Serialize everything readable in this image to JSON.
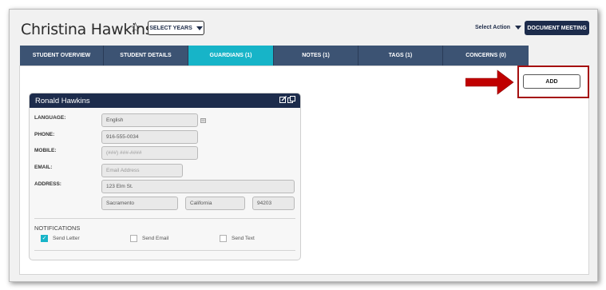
{
  "header": {
    "student_name": "Christina Hawkins",
    "star_icon": "star-outline-icon",
    "select_years_label": "SELECT YEARS",
    "select_action_label": "Select Action",
    "document_meeting_label": "DOCUMENT MEETING"
  },
  "tabs": [
    {
      "label": "STUDENT OVERVIEW",
      "active": false
    },
    {
      "label": "STUDENT DETAILS",
      "active": false
    },
    {
      "label": "GUARDIANS (1)",
      "active": true
    },
    {
      "label": "NOTES (1)",
      "active": false
    },
    {
      "label": "TAGS (1)",
      "active": false
    },
    {
      "label": "CONCERNS (0)",
      "active": false
    }
  ],
  "actions": {
    "add_label": "ADD"
  },
  "guardian": {
    "name": "Ronald Hawkins",
    "labels": {
      "language": "LANGUAGE:",
      "phone": "PHONE:",
      "mobile": "MOBILE:",
      "email": "EMAIL:",
      "address": "ADDRESS:"
    },
    "language": "English",
    "phone": "916-555-0034",
    "mobile_placeholder": "(###) ###-####",
    "email_placeholder": "Email Address",
    "street": "123 Elm St.",
    "city": "Sacramento",
    "state": "California",
    "zip": "94203",
    "notifications": {
      "title": "NOTIFICATIONS",
      "send_letter": {
        "label": "Send Letter",
        "checked": true
      },
      "send_email": {
        "label": "Send Email",
        "checked": false
      },
      "send_text": {
        "label": "Send Text",
        "checked": false
      }
    }
  },
  "colors": {
    "navy": "#1d2c4c",
    "tab": "#3c5373",
    "tab_active": "#17b4c8",
    "annotation_red": "#c00000"
  }
}
